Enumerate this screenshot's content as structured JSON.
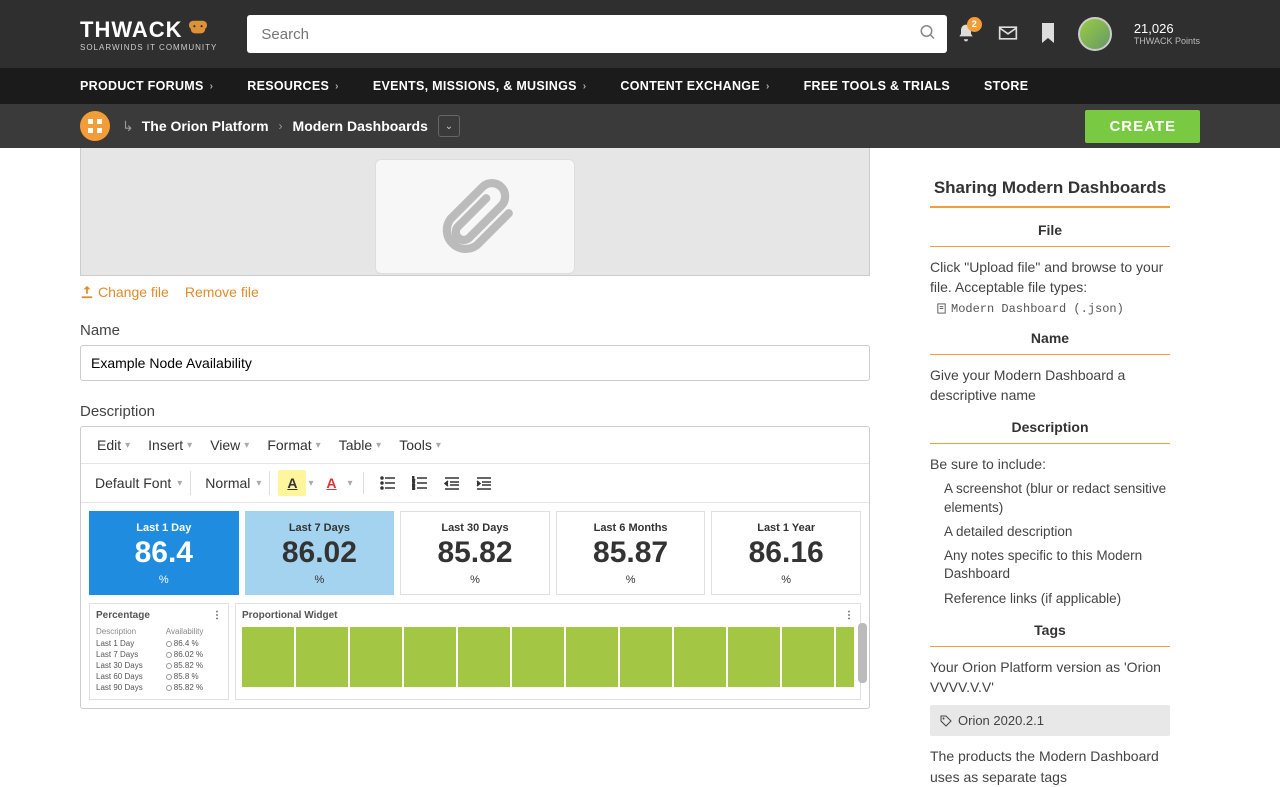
{
  "header": {
    "logo_main": "THWACK",
    "logo_sub": "SOLARWINDS IT COMMUNITY",
    "search_placeholder": "Search",
    "notif_count": "2",
    "points": "21,026",
    "points_label": "THWACK Points"
  },
  "nav": {
    "items": [
      "PRODUCT FORUMS",
      "RESOURCES",
      "EVENTS, MISSIONS, & MUSINGS",
      "CONTENT EXCHANGE",
      "FREE TOOLS & TRIALS",
      "STORE"
    ]
  },
  "breadcrumb": {
    "a": "The Orion Platform",
    "b": "Modern Dashboards",
    "create": "CREATE"
  },
  "file_actions": {
    "change": "Change file",
    "remove": "Remove file"
  },
  "form": {
    "name_label": "Name",
    "name_value": "Example Node Availability",
    "desc_label": "Description"
  },
  "editor": {
    "menu": [
      "Edit",
      "Insert",
      "View",
      "Format",
      "Table",
      "Tools"
    ],
    "font": "Default Font",
    "size": "Normal"
  },
  "tiles": [
    {
      "label": "Last 1 Day",
      "value": "86.4",
      "unit": "%"
    },
    {
      "label": "Last 7 Days",
      "value": "86.02",
      "unit": "%"
    },
    {
      "label": "Last 30 Days",
      "value": "85.82",
      "unit": "%"
    },
    {
      "label": "Last 6 Months",
      "value": "85.87",
      "unit": "%"
    },
    {
      "label": "Last 1 Year",
      "value": "86.16",
      "unit": "%"
    }
  ],
  "widgets": {
    "left_title": "Percentage",
    "right_title": "Proportional Widget",
    "table_headers": [
      "Description",
      "Availability"
    ],
    "rows": [
      {
        "d": "Last 1 Day",
        "v": "86.4 %"
      },
      {
        "d": "Last 7 Days",
        "v": "86.02 %"
      },
      {
        "d": "Last 30 Days",
        "v": "85.82 %"
      },
      {
        "d": "Last 60 Days",
        "v": "85.8 %"
      },
      {
        "d": "Last 90 Days",
        "v": "85.82 %"
      }
    ]
  },
  "sidebar": {
    "title": "Sharing Modern Dashboards",
    "file_h": "File",
    "file_p": "Click \"Upload file\" and browse to your file. Acceptable file types:",
    "file_type": "Modern Dashboard (.json)",
    "name_h": "Name",
    "name_p": "Give your Modern Dashboard a descriptive name",
    "desc_h": "Description",
    "desc_p": "Be sure to include:",
    "bullets": [
      "A screenshot (blur or redact sensitive elements)",
      "A detailed description",
      "Any notes specific to this Modern Dashboard",
      "Reference links (if applicable)"
    ],
    "tags_h": "Tags",
    "tags_p": "Your Orion Platform version as 'Orion VVVV.V.V'",
    "tag_example": "Orion 2020.2.1",
    "tags_p2": "The products the Modern Dashboard uses as separate tags"
  }
}
